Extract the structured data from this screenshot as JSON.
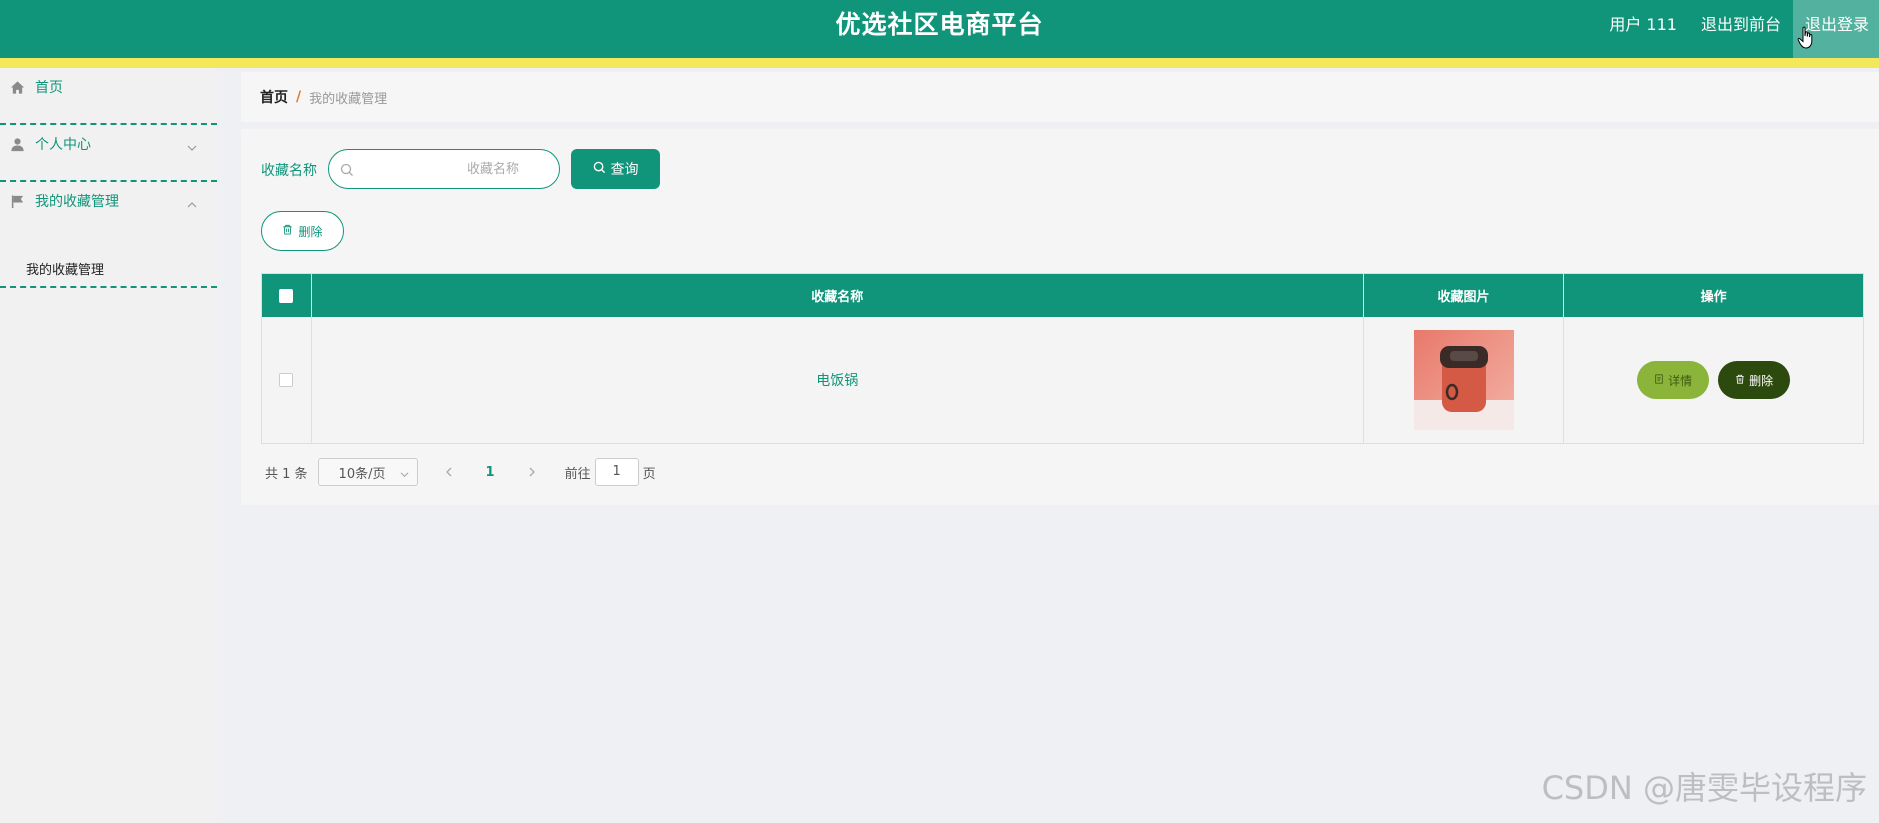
{
  "header": {
    "title": "优选社区电商平台",
    "user_label": "用户 111",
    "front_link": "退出到前台",
    "logout": "退出登录"
  },
  "sidebar": {
    "items": [
      {
        "label": "首页",
        "icon": "home-icon"
      },
      {
        "label": "个人中心",
        "icon": "user-icon",
        "chevron": "chevron-down-icon"
      },
      {
        "label": "我的收藏管理",
        "icon": "flag-icon",
        "chevron": "chevron-up-icon",
        "children": [
          {
            "label": "我的收藏管理"
          }
        ]
      }
    ]
  },
  "breadcrumb": {
    "home": "首页",
    "separator": "/",
    "current": "我的收藏管理"
  },
  "search": {
    "label": "收藏名称",
    "placeholder": "收藏名称",
    "query_button": "查询",
    "delete_button": "删除"
  },
  "table": {
    "columns": [
      "收藏名称",
      "收藏图片",
      "操作"
    ],
    "rows": [
      {
        "name": "电饭锅",
        "detail_button": "详情",
        "delete_button": "删除"
      }
    ]
  },
  "pagination": {
    "total": "共 1 条",
    "page_size": "10条/页",
    "current_page": "1",
    "goto_label": "前往",
    "goto_value": "1",
    "page_unit": "页"
  },
  "watermark": "CSDN @唐雯毕设程序",
  "colors": {
    "primary": "#10957a",
    "stripe": "#f2e85a",
    "detail_button": "#8bb53a",
    "delete_button": "#2d4a0e"
  }
}
